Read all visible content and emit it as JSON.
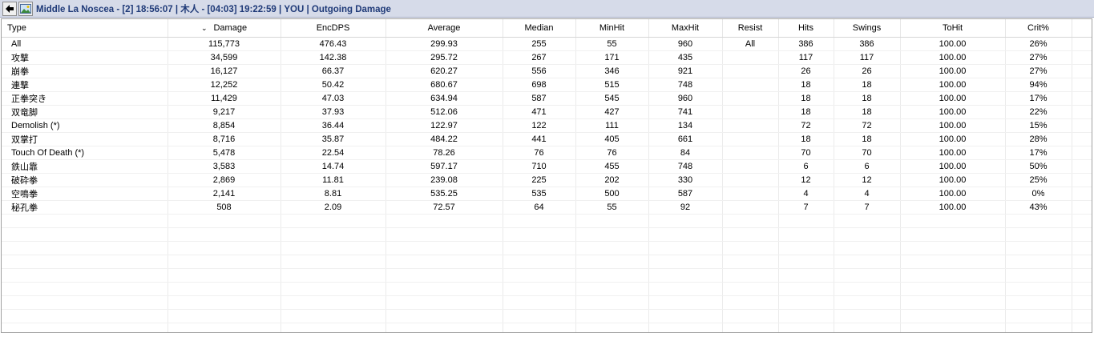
{
  "window": {
    "title": "Middle La Noscea - [2] 18:56:07 | 木人 - [04:03] 19:22:59  | YOU | Outgoing Damage"
  },
  "icons": {
    "back": "back-arrow-icon",
    "image": "picture-icon"
  },
  "table": {
    "sort_indicator": "⌄",
    "columns": [
      "Type",
      "Damage",
      "EncDPS",
      "Average",
      "Median",
      "MinHit",
      "MaxHit",
      "Resist",
      "Hits",
      "Swings",
      "ToHit",
      "Crit%"
    ],
    "rows": [
      [
        "All",
        "115,773",
        "476.43",
        "299.93",
        "255",
        "55",
        "960",
        "All",
        "386",
        "386",
        "100.00",
        "26%"
      ],
      [
        "攻撃",
        "34,599",
        "142.38",
        "295.72",
        "267",
        "171",
        "435",
        "",
        "117",
        "117",
        "100.00",
        "27%"
      ],
      [
        "崩拳",
        "16,127",
        "66.37",
        "620.27",
        "556",
        "346",
        "921",
        "",
        "26",
        "26",
        "100.00",
        "27%"
      ],
      [
        "連撃",
        "12,252",
        "50.42",
        "680.67",
        "698",
        "515",
        "748",
        "",
        "18",
        "18",
        "100.00",
        "94%"
      ],
      [
        "正拳突き",
        "11,429",
        "47.03",
        "634.94",
        "587",
        "545",
        "960",
        "",
        "18",
        "18",
        "100.00",
        "17%"
      ],
      [
        "双竜脚",
        "9,217",
        "37.93",
        "512.06",
        "471",
        "427",
        "741",
        "",
        "18",
        "18",
        "100.00",
        "22%"
      ],
      [
        "Demolish (*)",
        "8,854",
        "36.44",
        "122.97",
        "122",
        "111",
        "134",
        "",
        "72",
        "72",
        "100.00",
        "15%"
      ],
      [
        "双掌打",
        "8,716",
        "35.87",
        "484.22",
        "441",
        "405",
        "661",
        "",
        "18",
        "18",
        "100.00",
        "28%"
      ],
      [
        "Touch Of Death (*)",
        "5,478",
        "22.54",
        "78.26",
        "76",
        "76",
        "84",
        "",
        "70",
        "70",
        "100.00",
        "17%"
      ],
      [
        "鉄山靠",
        "3,583",
        "14.74",
        "597.17",
        "710",
        "455",
        "748",
        "",
        "6",
        "6",
        "100.00",
        "50%"
      ],
      [
        "破砕拳",
        "2,869",
        "11.81",
        "239.08",
        "225",
        "202",
        "330",
        "",
        "12",
        "12",
        "100.00",
        "25%"
      ],
      [
        "空鳴拳",
        "2,141",
        "8.81",
        "535.25",
        "535",
        "500",
        "587",
        "",
        "4",
        "4",
        "100.00",
        "0%"
      ],
      [
        "秘孔拳",
        "508",
        "2.09",
        "72.57",
        "64",
        "55",
        "92",
        "",
        "7",
        "7",
        "100.00",
        "43%"
      ]
    ]
  }
}
